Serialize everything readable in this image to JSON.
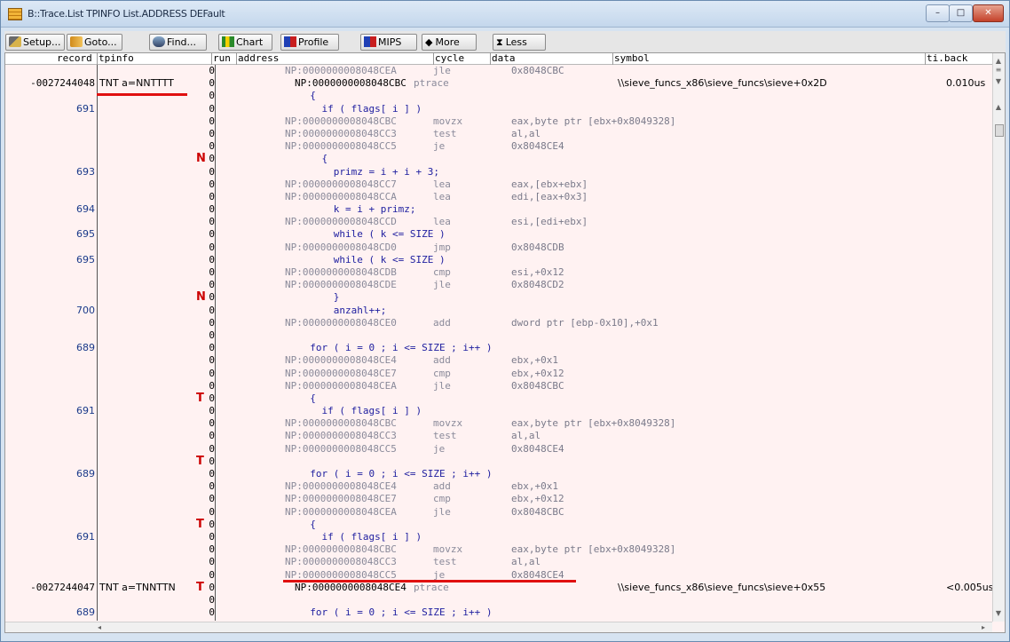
{
  "window": {
    "title": "B::Trace.List TPINFO List.ADDRESS DEFault"
  },
  "toolbar": [
    {
      "label": "Setup...",
      "icon": "wrench-icon"
    },
    {
      "label": "Goto...",
      "icon": "goto-icon"
    },
    {
      "label": "Find...",
      "icon": "find-icon"
    },
    {
      "label": "Chart",
      "icon": "chart-icon"
    },
    {
      "label": "Profile",
      "icon": "profile-icon"
    },
    {
      "label": "MIPS",
      "icon": "mips-icon"
    },
    {
      "label": "More",
      "icon": "more-icon"
    },
    {
      "label": "Less",
      "icon": "less-icon"
    }
  ],
  "columns": {
    "record": "record",
    "tpinfo": "tpinfo",
    "run": "run",
    "address": "address",
    "cycle": "cycle",
    "data": "data",
    "symbol": "symbol",
    "tiback": "ti.back"
  },
  "rows": [
    {
      "addr": "NP:0000000008048CEA",
      "mn": "jle",
      "ops": "0x8048CBC"
    },
    {
      "rec": "-0027244048",
      "tp": "TNT a=NNTTTT",
      "baddr": "NP:0000000008048CBC",
      "mn": "ptrace",
      "sym": "\\\\sieve_funcs_x86\\sieve_funcs\\sieve+0x2D",
      "ti": "0.010us"
    },
    {
      "src": "  {"
    },
    {
      "line": "691",
      "src": "    if ( flags[ i ] )"
    },
    {
      "addr": "NP:0000000008048CBC",
      "mn": "movzx",
      "ops": "eax,byte ptr [ebx+0x8049328]"
    },
    {
      "addr": "NP:0000000008048CC3",
      "mn": "test",
      "ops": "al,al"
    },
    {
      "addr": "NP:0000000008048CC5",
      "mn": "je",
      "ops": "0x8048CE4"
    },
    {
      "mark": "N",
      "src": "    {"
    },
    {
      "line": "693",
      "src": "      primz = i + i + 3;"
    },
    {
      "addr": "NP:0000000008048CC7",
      "mn": "lea",
      "ops": "eax,[ebx+ebx]"
    },
    {
      "addr": "NP:0000000008048CCA",
      "mn": "lea",
      "ops": "edi,[eax+0x3]"
    },
    {
      "line": "694",
      "src": "      k = i + primz;"
    },
    {
      "addr": "NP:0000000008048CCD",
      "mn": "lea",
      "ops": "esi,[edi+ebx]"
    },
    {
      "line": "695",
      "src": "      while ( k <= SIZE )"
    },
    {
      "addr": "NP:0000000008048CD0",
      "mn": "jmp",
      "ops": "0x8048CDB"
    },
    {
      "line": "695",
      "src": "      while ( k <= SIZE )"
    },
    {
      "addr": "NP:0000000008048CDB",
      "mn": "cmp",
      "ops": "esi,+0x12"
    },
    {
      "addr": "NP:0000000008048CDE",
      "mn": "jle",
      "ops": "0x8048CD2"
    },
    {
      "mark": "N",
      "src": "      }"
    },
    {
      "line": "700",
      "src": "      anzahl++;"
    },
    {
      "addr": "NP:0000000008048CE0",
      "mn": "add",
      "ops": "dword ptr [ebp-0x10],+0x1"
    },
    {
      "src": ""
    },
    {
      "line": "689",
      "src": "  for ( i = 0 ; i <= SIZE ; i++ )"
    },
    {
      "addr": "NP:0000000008048CE4",
      "mn": "add",
      "ops": "ebx,+0x1"
    },
    {
      "addr": "NP:0000000008048CE7",
      "mn": "cmp",
      "ops": "ebx,+0x12"
    },
    {
      "addr": "NP:0000000008048CEA",
      "mn": "jle",
      "ops": "0x8048CBC"
    },
    {
      "mark": "T",
      "src": "  {"
    },
    {
      "line": "691",
      "src": "    if ( flags[ i ] )"
    },
    {
      "addr": "NP:0000000008048CBC",
      "mn": "movzx",
      "ops": "eax,byte ptr [ebx+0x8049328]"
    },
    {
      "addr": "NP:0000000008048CC3",
      "mn": "test",
      "ops": "al,al"
    },
    {
      "addr": "NP:0000000008048CC5",
      "mn": "je",
      "ops": "0x8048CE4"
    },
    {
      "mark": "T",
      "src": ""
    },
    {
      "line": "689",
      "src": "  for ( i = 0 ; i <= SIZE ; i++ )"
    },
    {
      "addr": "NP:0000000008048CE4",
      "mn": "add",
      "ops": "ebx,+0x1"
    },
    {
      "addr": "NP:0000000008048CE7",
      "mn": "cmp",
      "ops": "ebx,+0x12"
    },
    {
      "addr": "NP:0000000008048CEA",
      "mn": "jle",
      "ops": "0x8048CBC"
    },
    {
      "mark": "T",
      "src": "  {"
    },
    {
      "line": "691",
      "src": "    if ( flags[ i ] )"
    },
    {
      "addr": "NP:0000000008048CBC",
      "mn": "movzx",
      "ops": "eax,byte ptr [ebx+0x8049328]"
    },
    {
      "addr": "NP:0000000008048CC3",
      "mn": "test",
      "ops": "al,al"
    },
    {
      "addr": "NP:0000000008048CC5",
      "mn": "je",
      "ops": "0x8048CE4"
    },
    {
      "rec": "-0027244047",
      "tp": "TNT a=TNNTTN",
      "mark": "T",
      "baddr": "NP:0000000008048CE4",
      "mn": "ptrace",
      "sym": "\\\\sieve_funcs_x86\\sieve_funcs\\sieve+0x55",
      "ti": "<0.005us"
    },
    {
      "src": ""
    },
    {
      "line": "689",
      "src": "  for ( i = 0 ; i <= SIZE ; i++ )"
    }
  ]
}
